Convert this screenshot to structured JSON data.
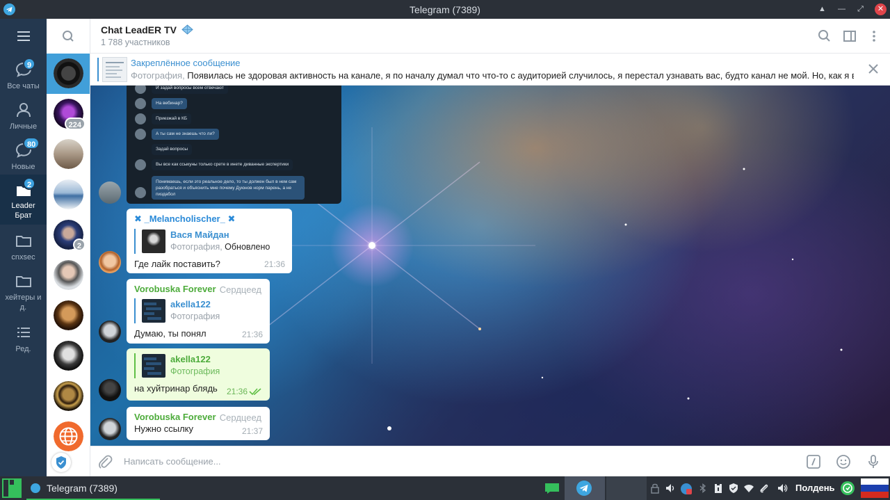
{
  "window": {
    "title": "Telegram (7389)"
  },
  "folders": [
    {
      "label": "Все чаты",
      "icon": "chat-bubble-icon",
      "badge": "9"
    },
    {
      "label": "Личные",
      "icon": "person-icon",
      "badge": ""
    },
    {
      "label": "Новые",
      "icon": "chat-bubble-icon",
      "badge": "80"
    },
    {
      "label": "Leader Брат",
      "icon": "folder-icon",
      "badge": "2"
    },
    {
      "label": "cnxsec",
      "icon": "folder-icon",
      "badge": ""
    },
    {
      "label": "хейтеры и д.",
      "icon": "folder-icon",
      "badge": ""
    },
    {
      "label": "Ред.",
      "icon": "edit-list-icon",
      "badge": ""
    }
  ],
  "chat_list": {
    "unread_counts": [
      "224",
      "2"
    ]
  },
  "header": {
    "title": "Chat LeadER TV",
    "subtitle": "1 788 участников"
  },
  "pinned": {
    "title": "Закреплённое сообщение",
    "prefix": "Фотография, ",
    "text": "Появилась не здоровая активность на канале, я по началу думал что что-то с аудиторией случилось, я перестал узнавать вас, будто канал не мой. Но, как я вы..."
  },
  "screenshot_messages": [
    "И задай вопросы всем отвечают",
    "На вебинар?",
    "Приезжай в КБ",
    "А ты сам не знаешь что ли?",
    "Задай вопросы",
    "Вы все как ссыкуны только срете в инете диванные экспертики",
    "Понимаешь, если это реальное дело, то ты должен был в нем сам разобраться и объяснить мне почему Дуюнов норм парень, а не пиздабол"
  ],
  "messages": [
    {
      "sender": "✖ _Melancholischer_ ✖",
      "reply_name": "Вася Майдан",
      "reply_prefix": "Фотография, ",
      "reply_text": "Обновлено",
      "text": "Где лайк поставить?",
      "time": "21:36"
    },
    {
      "sender": "Vorobuska Forever",
      "rank": "Сердцеед",
      "reply_name": "akella122",
      "reply_text": "Фотография",
      "text": "Думаю, ты понял",
      "time": "21:36"
    },
    {
      "reply_name": "akella122",
      "reply_text": "Фотография",
      "text": "на хуйтринар блядь",
      "time": "21:36"
    },
    {
      "sender": "Vorobuska Forever",
      "rank": "Сердцеед",
      "text": "Нужно ссылку",
      "time": "21:37"
    }
  ],
  "composer": {
    "placeholder": "Написать сообщение..."
  },
  "taskbar": {
    "task_label": "Telegram (7389)",
    "clock": "Полдень"
  },
  "colors": {
    "rail": "#24384f",
    "accent": "#419fd9",
    "green_sender": "#4cab3a",
    "own_bubble": "#effdde"
  }
}
